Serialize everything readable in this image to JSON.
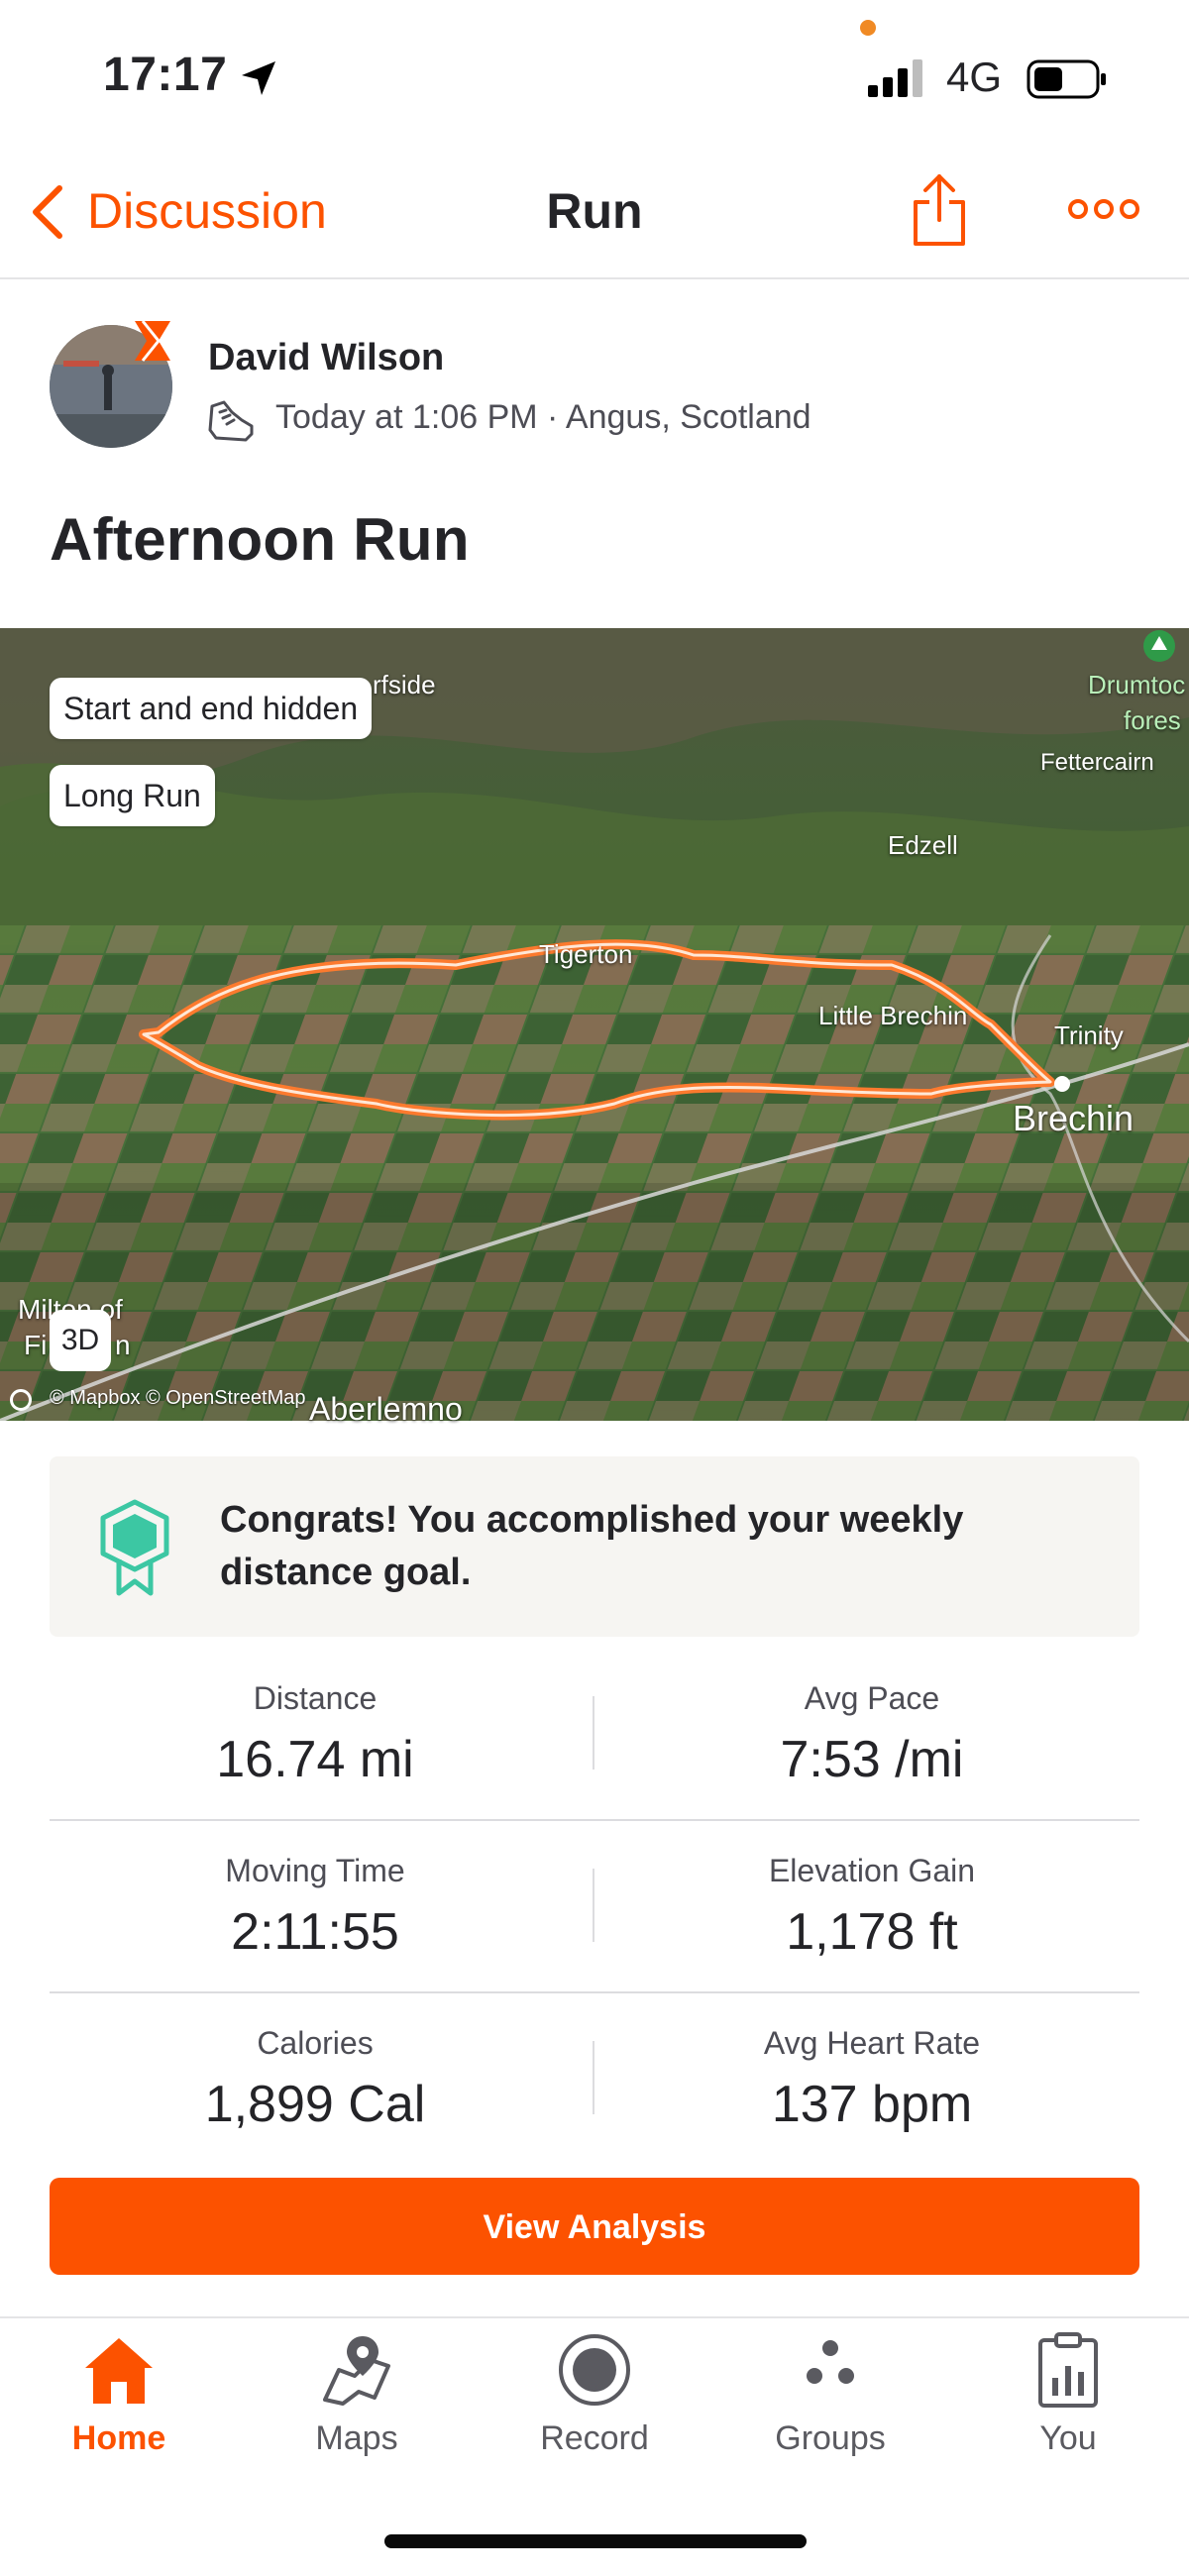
{
  "status_bar": {
    "time": "17:17",
    "network": "4G"
  },
  "nav": {
    "back_label": "Discussion",
    "title": "Run",
    "share_icon": "share-icon",
    "more_icon": "more-icon"
  },
  "athlete": {
    "name": "David Wilson",
    "meta": "Today at 1:06 PM · Angus, Scotland"
  },
  "activity": {
    "title": "Afternoon Run"
  },
  "map": {
    "chips": [
      "Start and end hidden",
      "Long Run"
    ],
    "view_mode": "3D",
    "attribution": "© Mapbox © OpenStreetMap",
    "places": {
      "fullside": "rfside",
      "drumtochty": "Drumtoc",
      "forest": "fores",
      "fettercairn": "Fettercairn",
      "edzell": "Edzell",
      "tigerton": "Tigerton",
      "little_brechin": "Little Brechin",
      "trinity": "Trinity",
      "brechin": "Brechin",
      "milton_1": "Milton of",
      "milton_2": "Fi",
      "milton_3": "n",
      "aberlemno": "Aberlemno"
    },
    "route_color": "#fc7a2e"
  },
  "goal": {
    "text": "Congrats! You accomplished your weekly distance goal.",
    "icon": "goal-badge-icon",
    "accent": "#3cc7a3"
  },
  "stats": [
    {
      "label": "Distance",
      "value": "16.74 mi"
    },
    {
      "label": "Avg Pace",
      "value": "7:53 /mi"
    },
    {
      "label": "Moving Time",
      "value": "2:11:55"
    },
    {
      "label": "Elevation Gain",
      "value": "1,178 ft"
    },
    {
      "label": "Calories",
      "value": "1,899 Cal"
    },
    {
      "label": "Avg Heart Rate",
      "value": "137 bpm"
    }
  ],
  "cta": {
    "label": "View Analysis",
    "color": "#fc5200"
  },
  "tabs": [
    {
      "label": "Home",
      "icon": "home-icon",
      "active": true
    },
    {
      "label": "Maps",
      "icon": "maps-icon"
    },
    {
      "label": "Record",
      "icon": "record-icon"
    },
    {
      "label": "Groups",
      "icon": "groups-icon"
    },
    {
      "label": "You",
      "icon": "you-icon"
    }
  ],
  "colors": {
    "brand": "#fc5200",
    "text": "#242428",
    "muted": "#4d4d55"
  }
}
